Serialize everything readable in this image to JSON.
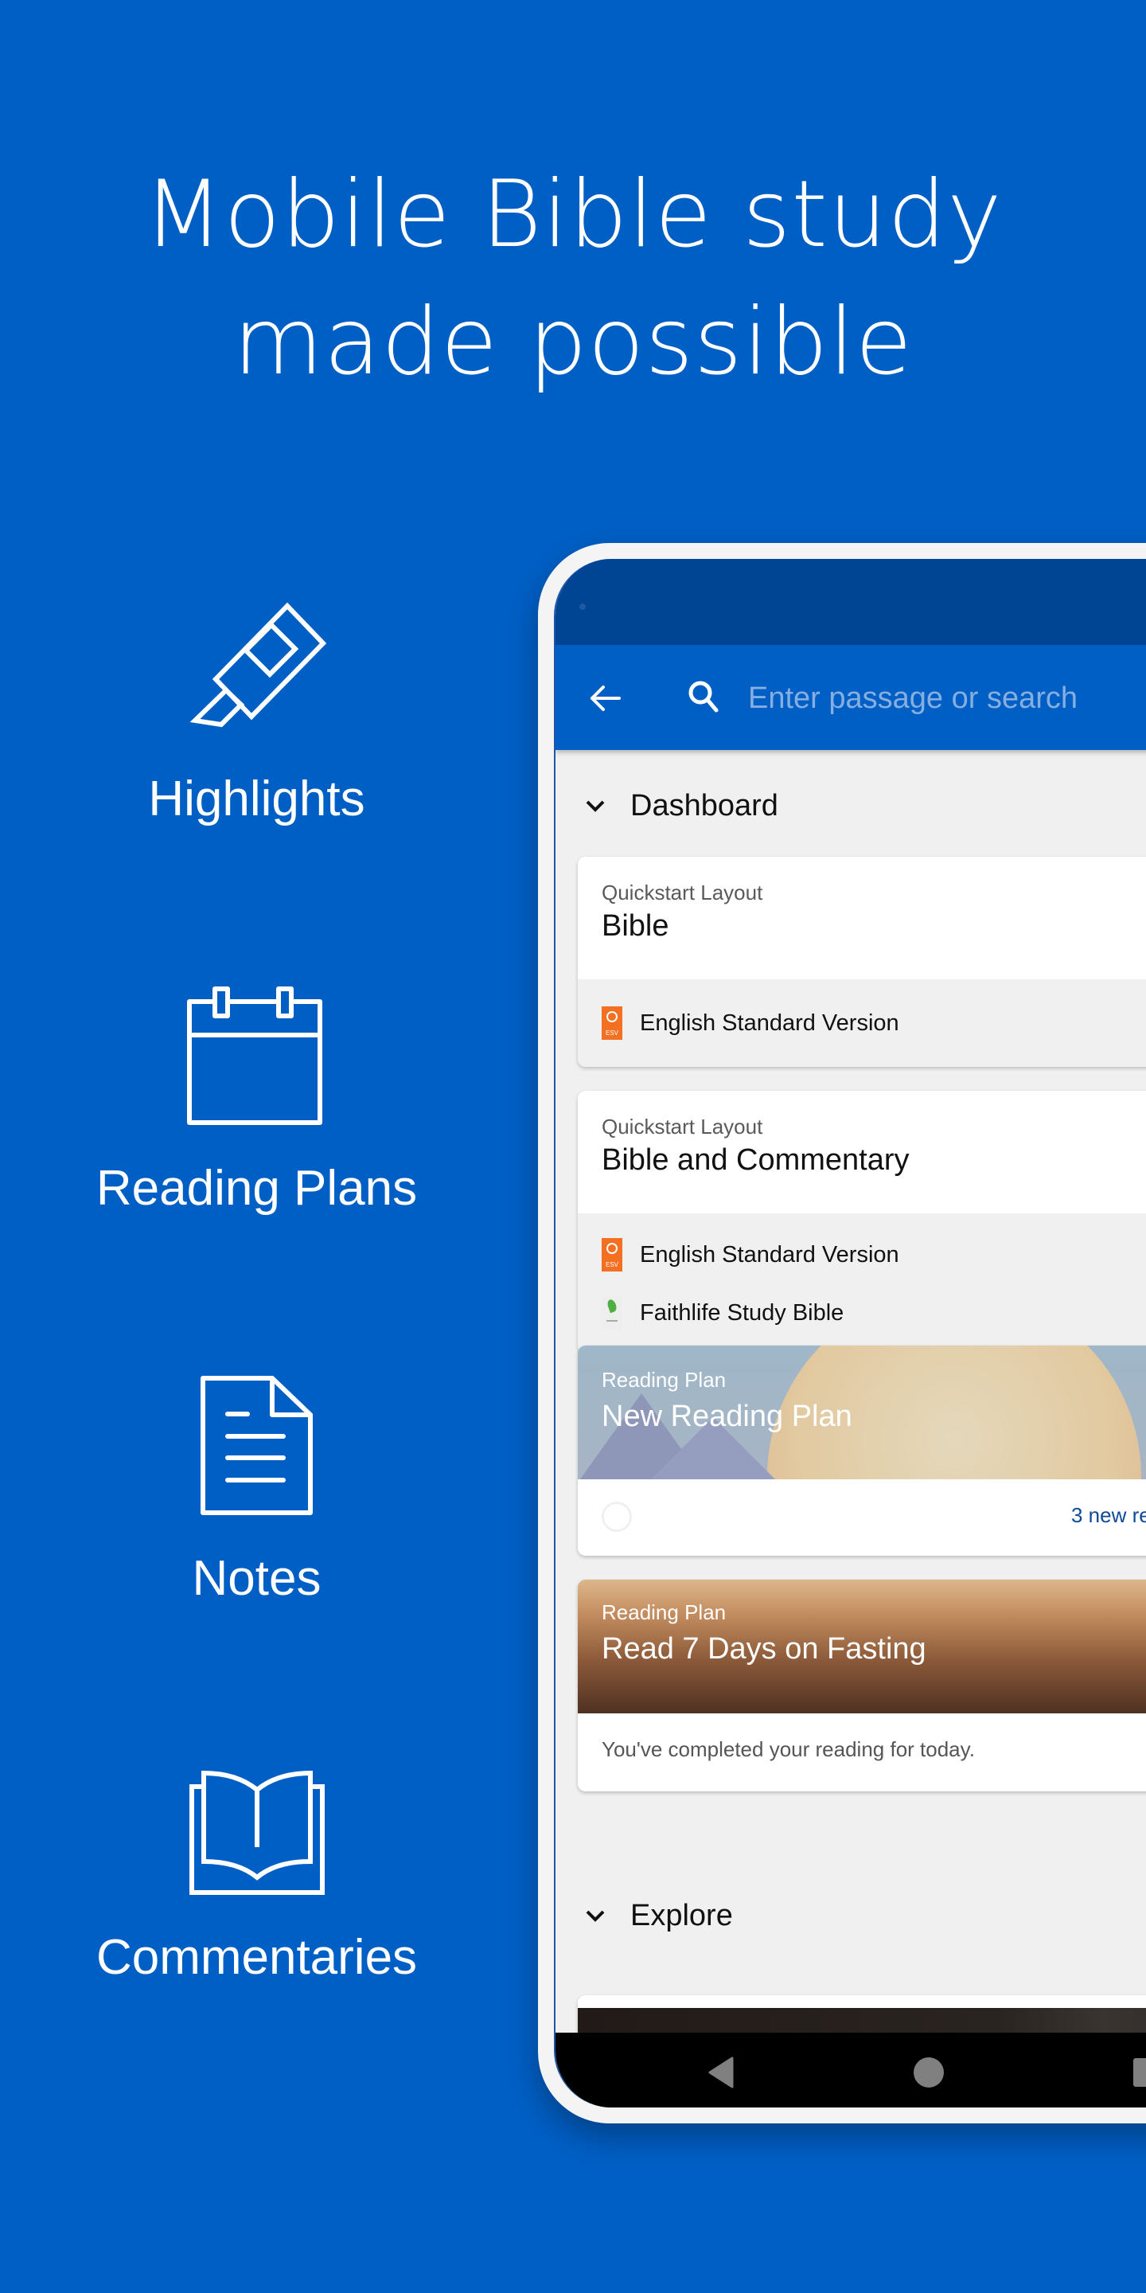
{
  "headline": {
    "line1": "Mobile Bible study",
    "line2": "made possible"
  },
  "features": [
    {
      "icon": "highlighter-icon",
      "label": "Highlights"
    },
    {
      "icon": "calendar-icon",
      "label": "Reading Plans"
    },
    {
      "icon": "document-icon",
      "label": "Notes"
    },
    {
      "icon": "open-book-icon",
      "label": "Commentaries"
    }
  ],
  "colors": {
    "background": "#005fc5",
    "status_bar": "#004494",
    "app_bar": "#005fc5",
    "esv_orange": "#f36f21",
    "link_blue": "#0e4a96"
  },
  "app": {
    "search": {
      "placeholder": "Enter passage or search",
      "value": ""
    },
    "sections": {
      "dashboard": "Dashboard",
      "explore": "Explore"
    },
    "cards": [
      {
        "kicker": "Quickstart Layout",
        "title": "Bible",
        "resources": [
          {
            "icon": "esv-icon",
            "icon_text": "ESV",
            "name": "English Standard Version"
          }
        ]
      },
      {
        "kicker": "Quickstart Layout",
        "title": "Bible and Commentary",
        "resources": [
          {
            "icon": "esv-icon",
            "icon_text": "ESV",
            "name": "English Standard Version"
          },
          {
            "icon": "faithlife-study-bible-icon",
            "name": "Faithlife Study Bible"
          }
        ]
      }
    ],
    "plans": [
      {
        "kicker": "Reading Plan",
        "title": "New Reading Plan",
        "footer_link": "3 new re"
      },
      {
        "kicker": "Reading Plan",
        "title": "Read 7 Days on Fasting",
        "footer_status": "You've completed your reading for today."
      }
    ]
  }
}
